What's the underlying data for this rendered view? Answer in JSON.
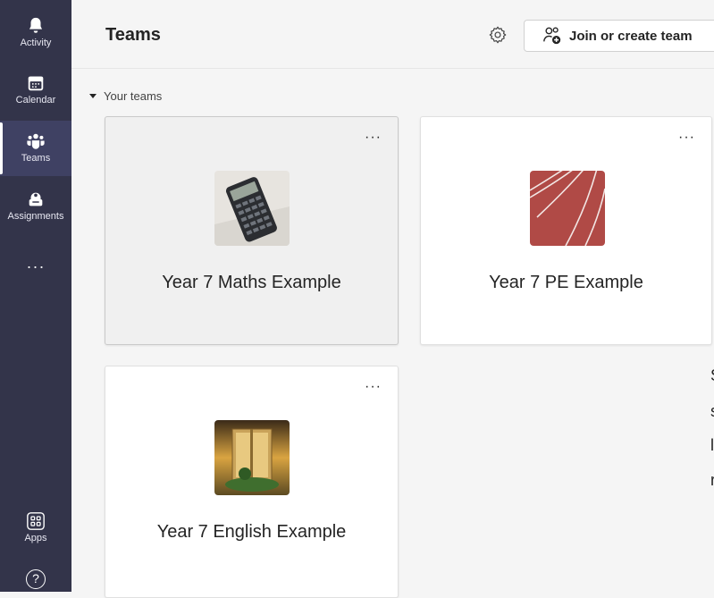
{
  "rail": {
    "items": [
      {
        "label": "Activity",
        "icon": "bell-icon"
      },
      {
        "label": "Calendar",
        "icon": "calendar-icon"
      },
      {
        "label": "Teams",
        "icon": "teams-icon",
        "active": true
      },
      {
        "label": "Assignments",
        "icon": "assignments-icon"
      }
    ],
    "more_label": "···",
    "apps_label": "Apps",
    "help_label": "?"
  },
  "header": {
    "title": "Teams",
    "join_button_label": "Join or create team"
  },
  "section": {
    "label": "Your teams"
  },
  "teams": [
    {
      "name": "Year 7 Maths Example",
      "more": "···"
    },
    {
      "name": "Year 7 PE Example",
      "more": "···"
    },
    {
      "name": "Year 7 English Example",
      "more": "···"
    }
  ],
  "right_edge_chars": [
    "S",
    "s",
    "l",
    "r"
  ],
  "colors": {
    "rail_bg": "#33344a",
    "accent": "#6264a7"
  }
}
